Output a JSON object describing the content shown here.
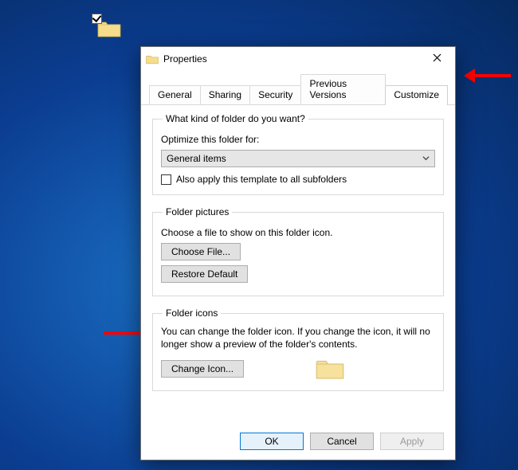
{
  "desktop_item": {
    "checked": true
  },
  "dialog": {
    "title": "Properties",
    "tabs": [
      {
        "label": "General"
      },
      {
        "label": "Sharing"
      },
      {
        "label": "Security"
      },
      {
        "label": "Previous Versions"
      },
      {
        "label": "Customize",
        "active": true
      }
    ],
    "groups": {
      "kind": {
        "legend": "What kind of folder do you want?",
        "optimize_label": "Optimize this folder for:",
        "combo_value": "General items",
        "subfolders_checkbox": "Also apply this template to all subfolders",
        "subfolders_checked": false
      },
      "pictures": {
        "legend": "Folder pictures",
        "desc": "Choose a file to show on this folder icon.",
        "choose_btn": "Choose File...",
        "restore_btn": "Restore Default"
      },
      "icons": {
        "legend": "Folder icons",
        "desc": "You can change the folder icon. If you change the icon, it will no longer show a preview of the folder's contents.",
        "change_btn": "Change Icon..."
      }
    },
    "buttons": {
      "ok": "OK",
      "cancel": "Cancel",
      "apply": "Apply"
    }
  },
  "colors": {
    "arrow": "#ff0000"
  }
}
